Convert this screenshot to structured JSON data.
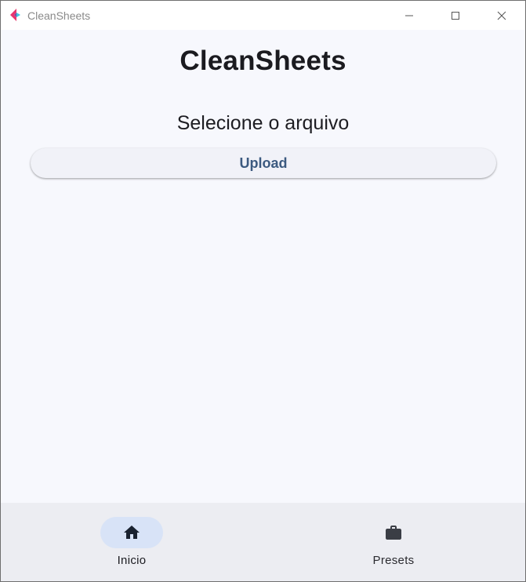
{
  "window": {
    "title": "CleanSheets"
  },
  "main": {
    "heading": "CleanSheets",
    "subheading": "Selecione o arquivo",
    "upload_label": "Upload"
  },
  "bottom_nav": {
    "items": [
      {
        "label": "Inicio",
        "icon": "home-icon",
        "active": true
      },
      {
        "label": "Presets",
        "icon": "briefcase-icon",
        "active": false
      }
    ]
  },
  "colors": {
    "background": "#f7f8fd",
    "nav_background": "#ecedf2",
    "nav_active_indicator": "#d8e3f7",
    "button_text": "#3c5a80",
    "logo_pink": "#e8366e",
    "logo_cyan": "#3ec6e0"
  }
}
